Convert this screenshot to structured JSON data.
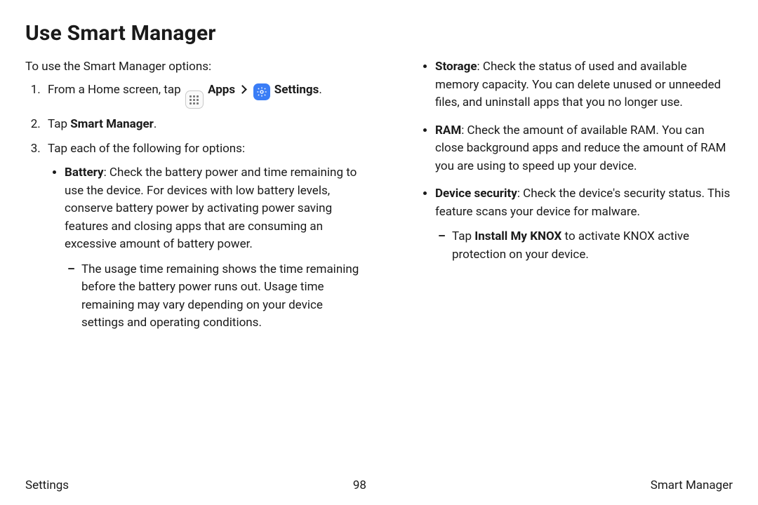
{
  "heading": "Use Smart Manager",
  "intro": "To use the Smart Manager options:",
  "step1_prefix": "From a Home screen, tap ",
  "step1_apps": "Apps",
  "step1_settings": "Settings",
  "step1_period": ".",
  "step2_prefix": "Tap ",
  "step2_bold": "Smart Manager",
  "step2_period": ".",
  "step3": "Tap each of the following for options:",
  "battery_bold": "Battery",
  "battery_text": ": Check the battery power and time remaining to use the device. For devices with low battery levels, conserve battery power by activating power saving features and closing apps that are consuming an excessive amount of battery power.",
  "battery_sub": "The usage time remaining shows the time remaining before the battery power runs out. Usage time remaining may vary depending on your device settings and operating conditions.",
  "storage_bold": "Storage",
  "storage_text": ": Check the status of used and available memory capacity. You can delete unused or unneeded files, and uninstall apps that you no longer use.",
  "ram_bold": "RAM",
  "ram_text": ": Check the amount of available RAM. You can close background apps and reduce the amount of RAM you are using to speed up your device.",
  "security_bold": "Device security",
  "security_text": ": Check the device's security status. This feature scans your device for malware.",
  "knox_prefix": "Tap ",
  "knox_bold": "Install My KNOX",
  "knox_suffix": " to activate KNOX active protection on your device.",
  "footer_left": "Settings",
  "footer_center": "98",
  "footer_right": "Smart Manager"
}
